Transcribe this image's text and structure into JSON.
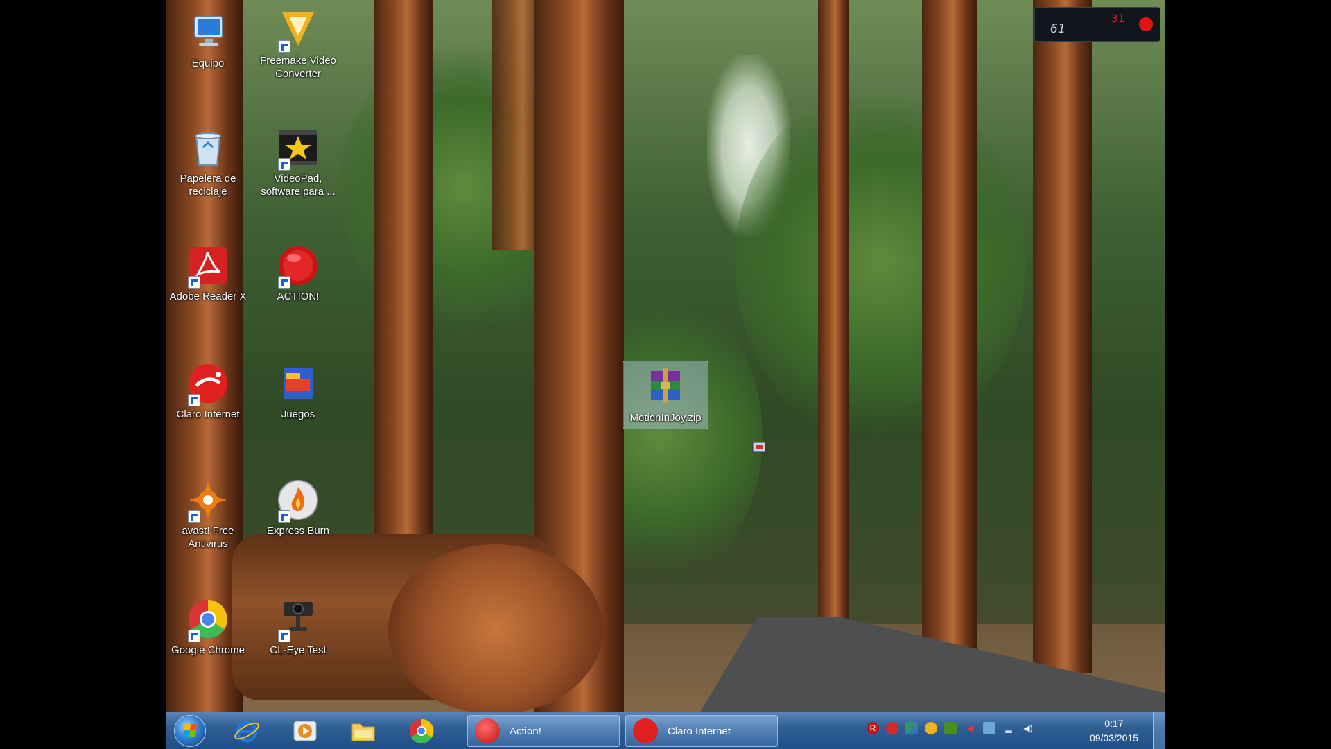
{
  "desktop": {
    "icons": [
      {
        "label": "Equipo",
        "icon": "computer-icon"
      },
      {
        "label": "Freemake Video Converter",
        "icon": "freemake-icon"
      },
      {
        "label": "Papelera de reciclaje",
        "icon": "recycle-bin-icon"
      },
      {
        "label": "VideoPad, software para ...",
        "icon": "videopad-icon"
      },
      {
        "label": "Adobe Reader X",
        "icon": "adobe-reader-icon"
      },
      {
        "label": "ACTION!",
        "icon": "action-icon"
      },
      {
        "label": "Claro Internet",
        "icon": "claro-icon"
      },
      {
        "label": "Juegos",
        "icon": "games-icon"
      },
      {
        "label": "avast! Free Antivirus",
        "icon": "avast-icon"
      },
      {
        "label": "Express Burn",
        "icon": "express-burn-icon"
      },
      {
        "label": "Google Chrome",
        "icon": "chrome-icon"
      },
      {
        "label": "CL-Eye Test",
        "icon": "webcam-icon"
      },
      {
        "label": "MotionInJoy.zip",
        "icon": "winrar-archive-icon"
      }
    ]
  },
  "recorder_widget": {
    "fps": "61",
    "indicator": "31"
  },
  "taskbar": {
    "tasks": [
      {
        "label": "Action!"
      },
      {
        "label": "Claro Internet"
      }
    ],
    "tray_icons": [
      "R",
      "stop-icon",
      "network-icon",
      "norton-icon",
      "nvidia-icon",
      "arrow-icon",
      "monitor-icon",
      "signal-icon",
      "volume-icon"
    ],
    "clock_time": "0:17",
    "clock_date": "09/03/2015"
  }
}
